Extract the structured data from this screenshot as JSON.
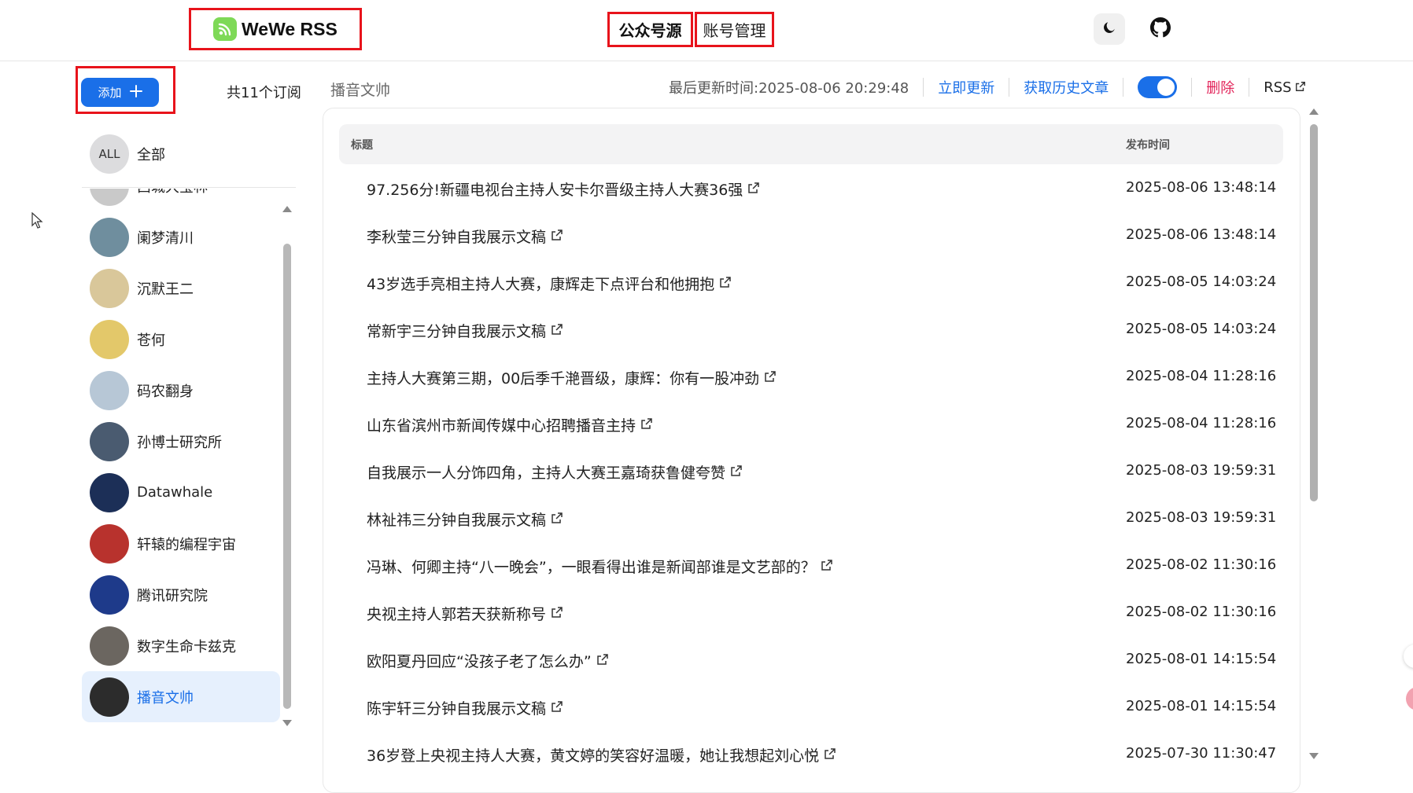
{
  "brand": {
    "name": "WeWe RSS",
    "accent": "#7ed957"
  },
  "nav": {
    "tab_feeds": "公众号源",
    "tab_accounts": "账号管理"
  },
  "header_icons": {
    "theme": "moon-icon",
    "github": "github-icon"
  },
  "sidebar": {
    "add_label": "添加",
    "add_icon": "plus-icon",
    "subscription_count": "共11个订阅",
    "all": {
      "avatar_text": "ALL",
      "label": "全部"
    },
    "accounts": [
      {
        "name": "西城大宝林",
        "avatar_color": "#c9c9c9",
        "selected": false
      },
      {
        "name": "阑梦清川",
        "avatar_color": "#6f8e9e",
        "selected": false
      },
      {
        "name": "沉默王二",
        "avatar_color": "#d9c79a",
        "selected": false
      },
      {
        "name": "苍何",
        "avatar_color": "#e3c86a",
        "selected": false
      },
      {
        "name": "码农翻身",
        "avatar_color": "#b7c7d6",
        "selected": false
      },
      {
        "name": "孙博士研究所",
        "avatar_color": "#4a5b70",
        "selected": false
      },
      {
        "name": "Datawhale",
        "avatar_color": "#1c2f57",
        "selected": false
      },
      {
        "name": "轩辕的编程宇宙",
        "avatar_color": "#b8322d",
        "selected": false
      },
      {
        "name": "腾讯研究院",
        "avatar_color": "#1e3a8a",
        "selected": false
      },
      {
        "name": "数字生命卡兹克",
        "avatar_color": "#6b6660",
        "selected": false
      },
      {
        "name": "播音文帅",
        "avatar_color": "#2c2c2c",
        "selected": true
      }
    ]
  },
  "toolbar": {
    "account_title": "播音文帅",
    "last_updated": "最后更新时间:2025-08-06 20:29:48",
    "update_now": "立即更新",
    "fetch_history": "获取历史文章",
    "enabled": true,
    "delete": "删除",
    "rss": "RSS"
  },
  "table": {
    "col_title": "标题",
    "col_date": "发布时间",
    "rows": [
      {
        "title": "97.256分!新疆电视台主持人安卡尔晋级主持人大赛36强",
        "date": "2025-08-06 13:48:14"
      },
      {
        "title": "李秋莹三分钟自我展示文稿",
        "date": "2025-08-06 13:48:14"
      },
      {
        "title": "43岁选手亮相主持人大赛，康辉走下点评台和他拥抱",
        "date": "2025-08-05 14:03:24"
      },
      {
        "title": "常新宇三分钟自我展示文稿",
        "date": "2025-08-05 14:03:24"
      },
      {
        "title": "主持人大赛第三期，00后季千滟晋级，康辉：你有一股冲劲",
        "date": "2025-08-04 11:28:16"
      },
      {
        "title": "山东省滨州市新闻传媒中心招聘播音主持",
        "date": "2025-08-04 11:28:16"
      },
      {
        "title": "自我展示一人分饰四角，主持人大赛王嘉琦获鲁健夸赞",
        "date": "2025-08-03 19:59:31"
      },
      {
        "title": "林祉祎三分钟自我展示文稿",
        "date": "2025-08-03 19:59:31"
      },
      {
        "title": "冯琳、何卿主持“八一晚会”，一眼看得出谁是新闻部谁是文艺部的？",
        "date": "2025-08-02 11:30:16"
      },
      {
        "title": "央视主持人郭若天获新称号",
        "date": "2025-08-02 11:30:16"
      },
      {
        "title": "欧阳夏丹回应“没孩子老了怎么办”",
        "date": "2025-08-01 14:15:54"
      },
      {
        "title": "陈宇轩三分钟自我展示文稿",
        "date": "2025-08-01 14:15:54"
      },
      {
        "title": "36岁登上央视主持人大赛，黄文婷的笑容好温暖，她让我想起刘心悦",
        "date": "2025-07-30 11:30:47"
      }
    ]
  },
  "colors": {
    "primary": "#1a6fe8",
    "danger": "#e2245a",
    "highlight_border": "#e8131b",
    "selected_bg": "#e6f0fd"
  }
}
